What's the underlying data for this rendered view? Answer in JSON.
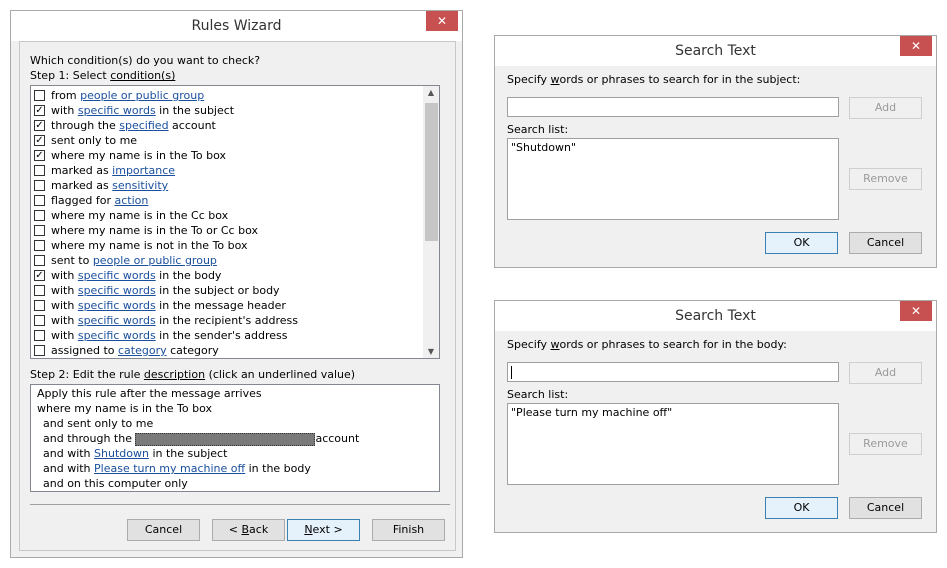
{
  "rules_wizard": {
    "title": "Rules Wizard",
    "close_glyph": "✕",
    "question": "Which condition(s) do you want to check?",
    "step1": {
      "prefix": "Step 1: Select ",
      "link": "condition(s)"
    },
    "conditions": [
      {
        "checked": false,
        "before": "from ",
        "link": "people or public group",
        "after": ""
      },
      {
        "checked": true,
        "before": "with ",
        "link": "specific words",
        "after": " in the subject"
      },
      {
        "checked": true,
        "before": "through the ",
        "link": "specified",
        "after": " account"
      },
      {
        "checked": true,
        "before": "sent only to me",
        "link": "",
        "after": ""
      },
      {
        "checked": true,
        "before": "where my name is in the To box",
        "link": "",
        "after": ""
      },
      {
        "checked": false,
        "before": "marked as ",
        "link": "importance",
        "after": ""
      },
      {
        "checked": false,
        "before": "marked as ",
        "link": "sensitivity",
        "after": ""
      },
      {
        "checked": false,
        "before": "flagged for ",
        "link": "action",
        "after": ""
      },
      {
        "checked": false,
        "before": "where my name is in the Cc box",
        "link": "",
        "after": ""
      },
      {
        "checked": false,
        "before": "where my name is in the To or Cc box",
        "link": "",
        "after": ""
      },
      {
        "checked": false,
        "before": "where my name is not in the To box",
        "link": "",
        "after": ""
      },
      {
        "checked": false,
        "before": "sent to ",
        "link": "people or public group",
        "after": ""
      },
      {
        "checked": true,
        "before": "with ",
        "link": "specific words",
        "after": " in the body"
      },
      {
        "checked": false,
        "before": "with ",
        "link": "specific words",
        "after": " in the subject or body"
      },
      {
        "checked": false,
        "before": "with ",
        "link": "specific words",
        "after": " in the message header"
      },
      {
        "checked": false,
        "before": "with ",
        "link": "specific words",
        "after": " in the recipient's address"
      },
      {
        "checked": false,
        "before": "with ",
        "link": "specific words",
        "after": " in the sender's address"
      },
      {
        "checked": false,
        "before": "assigned to ",
        "link": "category",
        "after": " category"
      }
    ],
    "step2": {
      "prefix": "Step 2: Edit the rule ",
      "link": "description",
      "suffix": " (click an underlined value)"
    },
    "description": {
      "line1": "Apply this rule after the message arrives",
      "line2": "where my name is in the To box",
      "line3": "and sent only to me",
      "line4_before": "and through the ",
      "line4_after": "account",
      "line5_before": "and with ",
      "line5_link": "Shutdown",
      "line5_after": " in the subject",
      "line6_before": "and with ",
      "line6_link": "Please turn my machine off",
      "line6_after": " in the body",
      "line7": "and on this computer only"
    },
    "buttons": {
      "cancel": "Cancel",
      "back_pre": "< ",
      "back_u": "B",
      "back_post": "ack",
      "next_u": "N",
      "next_post": "ext >",
      "finish": "Finish"
    }
  },
  "search_subject": {
    "title": "Search Text",
    "close_glyph": "✕",
    "prompt_pre": "Specify ",
    "prompt_u": "w",
    "prompt_post": "ords or phrases to search for in the subject:",
    "input_value": "",
    "add": "Add",
    "list_label": "Search list:",
    "items": [
      "\"Shutdown\""
    ],
    "remove": "Remove",
    "ok": "OK",
    "cancel": "Cancel"
  },
  "search_body": {
    "title": "Search Text",
    "close_glyph": "✕",
    "prompt_pre": "Specify ",
    "prompt_u": "w",
    "prompt_post": "ords or phrases to search for in the body:",
    "input_value": "",
    "add": "Add",
    "list_label": "Search list:",
    "items": [
      "\"Please turn my machine off\""
    ],
    "remove": "Remove",
    "ok": "OK",
    "cancel": "Cancel"
  }
}
